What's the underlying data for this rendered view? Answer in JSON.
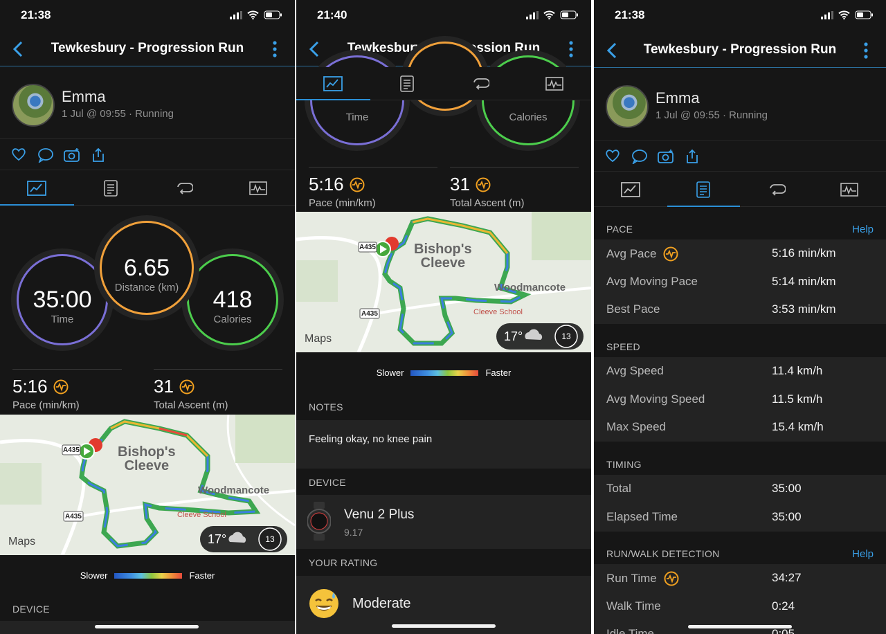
{
  "activity_title": "Tewkesbury - Progression Run",
  "user": {
    "name": "Emma",
    "meta": "1 Jul @ 09:55 · Running"
  },
  "panel1": {
    "time": "21:38",
    "rings": {
      "time": {
        "value": "35:00",
        "label": "Time"
      },
      "distance": {
        "value": "6.65",
        "label": "Distance (km)"
      },
      "calories": {
        "value": "418",
        "label": "Calories"
      }
    },
    "pace": {
      "value": "5:16",
      "label": "Pace (min/km)"
    },
    "ascent": {
      "value": "31",
      "label": "Total Ascent (m)"
    },
    "section_device": "DEVICE"
  },
  "map": {
    "town": "Bishop's\nCleeve",
    "woodmancote": "Woodmancote",
    "school": "Cleeve School",
    "road1": "A435",
    "road2": "A435",
    "provider": "Maps",
    "temperature": "17°",
    "wind": "13"
  },
  "legend": {
    "slower": "Slower",
    "faster": "Faster"
  },
  "panel2": {
    "time": "21:40",
    "rings": {
      "time_label": "Time",
      "calories_label": "Calories"
    },
    "pace": {
      "value": "5:16",
      "label": "Pace (min/km)"
    },
    "ascent": {
      "value": "31",
      "label": "Total Ascent (m)"
    },
    "notes_header": "NOTES",
    "notes_text": "Feeling okay, no knee pain",
    "device_header": "DEVICE",
    "device_name": "Venu 2 Plus",
    "device_version": "9.17",
    "rating_header": "YOUR RATING",
    "rating_value": "Moderate"
  },
  "panel3": {
    "time": "21:38",
    "help": "Help",
    "sections": [
      {
        "header": "PACE",
        "rows": [
          {
            "label": "Avg Pace",
            "value": "5:16 min/km"
          },
          {
            "label": "Avg Moving Pace",
            "value": "5:14 min/km"
          },
          {
            "label": "Best Pace",
            "value": "3:53 min/km"
          }
        ]
      },
      {
        "header": "SPEED",
        "rows": [
          {
            "label": "Avg Speed",
            "value": "11.4 km/h"
          },
          {
            "label": "Avg Moving Speed",
            "value": "11.5 km/h"
          },
          {
            "label": "Max Speed",
            "value": "15.4 km/h"
          }
        ]
      },
      {
        "header": "TIMING",
        "rows": [
          {
            "label": "Total",
            "value": "35:00"
          },
          {
            "label": "Elapsed Time",
            "value": "35:00"
          }
        ]
      },
      {
        "header": "RUN/WALK DETECTION",
        "rows": [
          {
            "label": "Run Time",
            "value": "34:27"
          },
          {
            "label": "Walk Time",
            "value": "0:24"
          },
          {
            "label": "Idle Time",
            "value": "0:05"
          }
        ]
      }
    ]
  },
  "colors": {
    "accent": "#2b8fd6",
    "time_ring": "#7a6fd6",
    "distance_ring": "#f0a03a",
    "calories_ring": "#4ccd4c",
    "pace_icon": "#f0a020"
  }
}
